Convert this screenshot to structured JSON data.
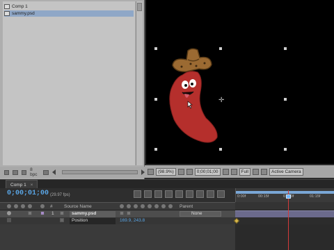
{
  "project": {
    "items": [
      {
        "label": "Comp 1",
        "icon": "composition-icon"
      },
      {
        "label": "sammy.psd",
        "icon": "psd-file-icon"
      }
    ],
    "bpc_label": "8 bpc"
  },
  "viewer": {
    "zoom": "(98.9%)",
    "timecode": "0;00;01;00",
    "resolution": "Full",
    "camera": "Active Camera"
  },
  "timeline": {
    "tab_label": "Comp 1",
    "tab_close": "×",
    "timecode": "0;00;01;00",
    "fps": "(29.97 fps)",
    "ruler_labels": [
      "0:00f",
      "00:15f",
      "01:00f",
      "01:15f"
    ],
    "columns": {
      "number": "#",
      "source_name": "Source Name",
      "parent": "Parent"
    },
    "layers": [
      {
        "number": "1",
        "name": "sammy.psd",
        "parent": "None"
      }
    ],
    "property": {
      "name": "Position",
      "value": "169.9, 243.8"
    }
  },
  "colors": {
    "accent_timecode": "#5aa6e6",
    "cti": "#d43a3a",
    "layer_bar": "#6b6a8c",
    "keyframe": "#d6b64a"
  }
}
